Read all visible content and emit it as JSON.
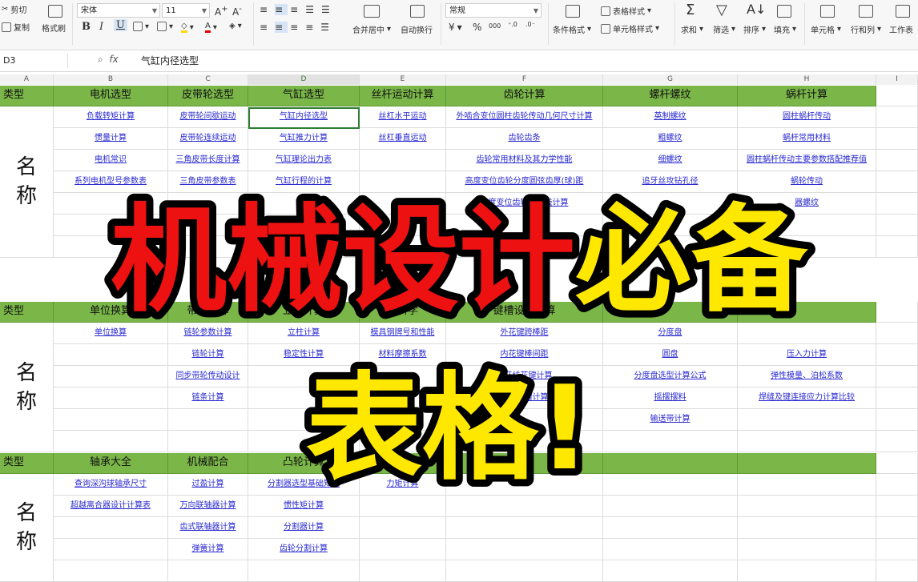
{
  "ribbon": {
    "cut": "剪切",
    "copy": "复制",
    "format_painter": "格式刷",
    "font_name": "宋体",
    "font_size": "11",
    "bold": "B",
    "italic": "I",
    "underline": "U",
    "merge_center": "合并居中",
    "wrap_text": "自动换行",
    "number_format": "常规",
    "currency": "¥",
    "percent": "%",
    "thousands": "000",
    "conditional_format": "条件格式",
    "table_style": "表格样式",
    "cell_style": "单元格样式",
    "sum": "求和",
    "filter": "筛选",
    "sort": "排序",
    "fill": "填充",
    "cells": "单元格",
    "rows_cols": "行和列",
    "worksheet": "工作表"
  },
  "formula_bar": {
    "cell_ref": "D3",
    "fx": "fx",
    "content": "气缸内径选型"
  },
  "columns": [
    "A",
    "B",
    "C",
    "D",
    "E",
    "F",
    "G",
    "H",
    "I"
  ],
  "section1": {
    "type_label": "类型",
    "headers": [
      "电机选型",
      "皮带轮选型",
      "气缸选型",
      "丝杆运动计算",
      "齿轮计算",
      "螺杆螺纹",
      "蜗杆计算"
    ],
    "name_label_1": "名",
    "name_label_2": "称",
    "rows": [
      [
        "负载转矩计算",
        "皮带轮间歇运动",
        "气缸内径选型",
        "丝杠水平运动",
        "外啮合变位圆柱齿轮传动几何尺寸计算",
        "英制螺纹",
        "圆柱蜗杆传动"
      ],
      [
        "惯量计算",
        "皮带轮连续运动",
        "气缸推力计算",
        "丝杠垂直运动",
        "齿轮齿条",
        "粗螺纹",
        "蜗杆常用材料"
      ],
      [
        "电机常识",
        "三角皮带长度计算",
        "气缸理论出力表",
        "",
        "齿轮常用材料及其力学性能",
        "细螺纹",
        "圆柱蜗杆传动主要参数搭配推荐值"
      ],
      [
        "系列电机型号参数表",
        "三角皮带参数表",
        "气缸行程的计算",
        "",
        "高度变位齿轮分度圆弦齿厚(球)距",
        "追牙丝攻钻孔径",
        "蜗轮传动"
      ],
      [
        "",
        "",
        "",
        "",
        "高度变位齿轮公法线计算",
        "",
        "器螺纹"
      ]
    ]
  },
  "section2": {
    "type_label": "类型",
    "headers": [
      "单位换算",
      "带轮计算",
      "立柱计算",
      "材料学",
      "键槽设计计算",
      "",
      ""
    ],
    "name_label_1": "名",
    "name_label_2": "称",
    "rows": [
      [
        "单位换算",
        "链轮参数计算",
        "立柱计算",
        "模具钢牌号和性能",
        "外花键跨棒距",
        "分度盘",
        ""
      ],
      [
        "",
        "链轮计算",
        "稳定性计算",
        "材料摩擦系数",
        "内花键棒间距",
        "圆盘",
        "压入力计算"
      ],
      [
        "",
        "同步带轮传动设计",
        "",
        "",
        "渐开线花键计算",
        "分度盘选型计算公式",
        "弹性模量、泊松系数"
      ],
      [
        "",
        "链条计算",
        "",
        "",
        "平键键槽计算",
        "摇摆摆料",
        "焊缝及键连接应力计算比较"
      ],
      [
        "",
        "",
        "",
        "",
        "",
        "输送带计算",
        ""
      ]
    ]
  },
  "section3": {
    "type_label": "类型",
    "headers": [
      "轴承大全",
      "机械配合",
      "凸轮计算",
      "力矩计算",
      "",
      "",
      ""
    ],
    "name_label_1": "名",
    "name_label_2": "称",
    "rows": [
      [
        "查询深沟球轴承尺寸",
        "过盈计算",
        "分割器选型基础知识",
        "力矩计算",
        "",
        "",
        ""
      ],
      [
        "超越离合器设计计算表",
        "万向联轴器计算",
        "惯性矩计算",
        "",
        "",
        "",
        ""
      ],
      [
        "",
        "齿式联轴器计算",
        "分割器计算",
        "",
        "",
        "",
        ""
      ],
      [
        "",
        "弹簧计算",
        "齿轮分割计算",
        "",
        "",
        "",
        ""
      ]
    ]
  },
  "overlay": {
    "title_red": "机械设计",
    "title_yellow": "必备",
    "subtitle": "表格!",
    "red": "#ee1111",
    "yellow": "#ffe800"
  },
  "colors": {
    "header_green": "#7ab648",
    "link_blue": "#2a2ad0",
    "selection": "#2e7d32"
  }
}
